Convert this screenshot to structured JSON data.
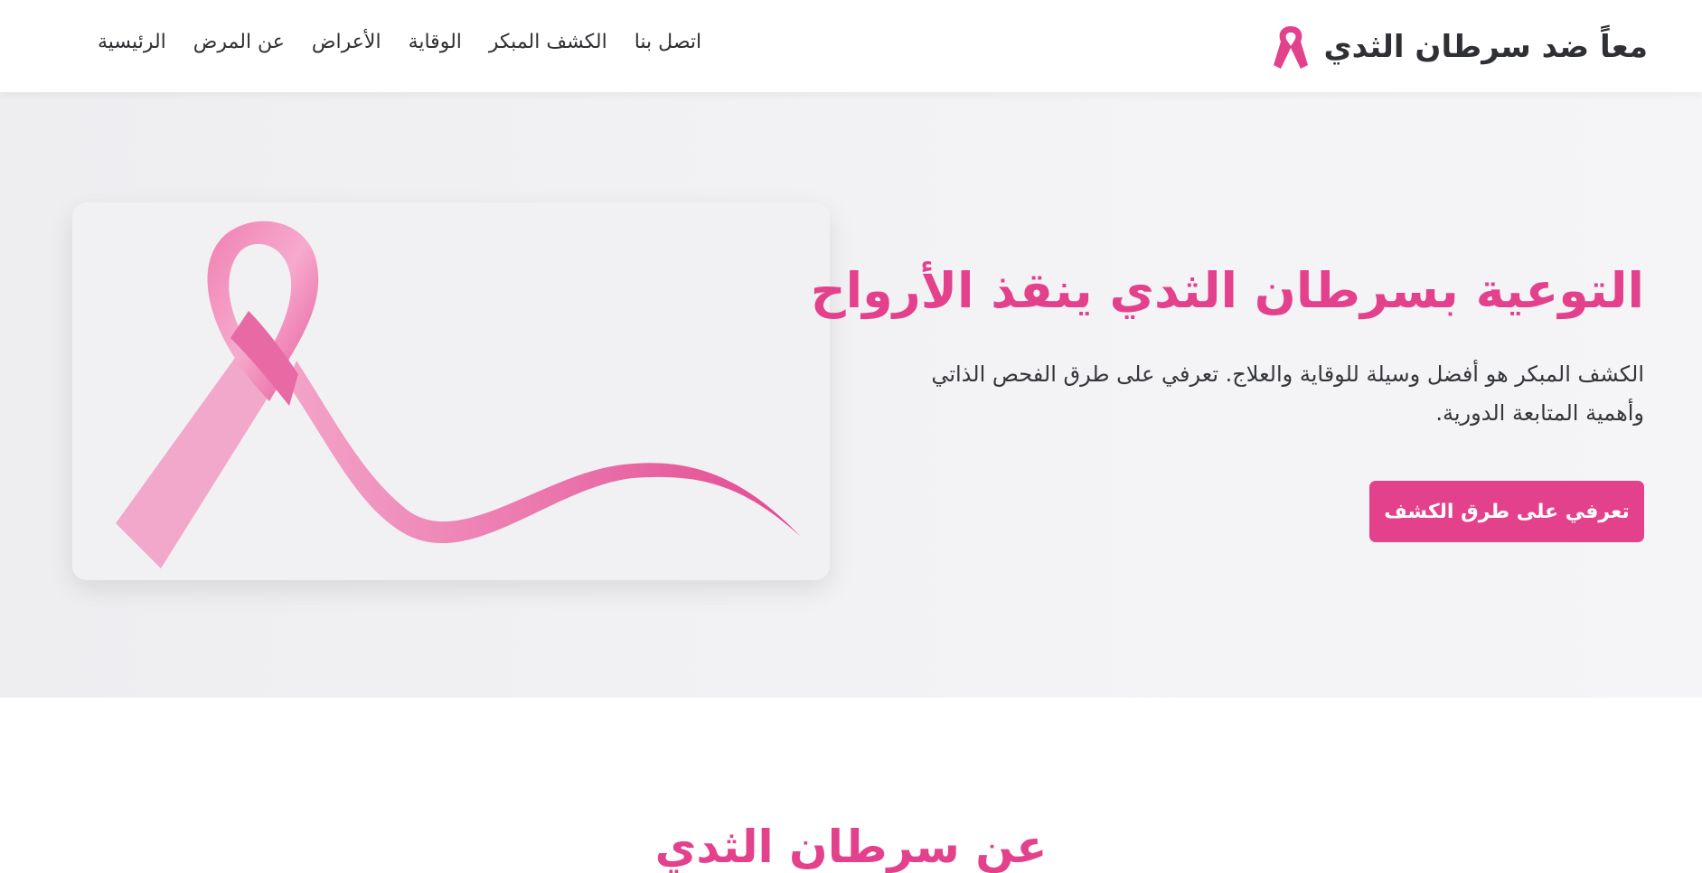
{
  "header": {
    "brand_title": "معاً ضد سرطان الثدي",
    "nav": [
      "الرئيسية",
      "عن المرض",
      "الأعراض",
      "الوقاية",
      "الكشف المبكر",
      "اتصل بنا"
    ]
  },
  "hero": {
    "title": "التوعية بسرطان الثدي ينقذ الأرواح",
    "description": "الكشف المبكر هو أفضل وسيلة للوقاية والعلاج. تعرفي على طرق الفحص الذاتي وأهمية المتابعة الدورية.",
    "button_label": "تعرفي على طرق الكشف"
  },
  "about": {
    "title": "عن سرطان الثدي"
  },
  "colors": {
    "accent": "#e3418c",
    "text": "#2f3033",
    "hero_bg": "#f2f2f4"
  },
  "icons": {
    "brand": "pink-ribbon-icon"
  }
}
